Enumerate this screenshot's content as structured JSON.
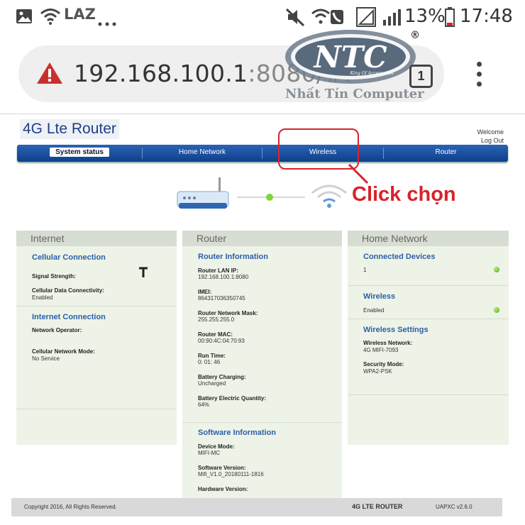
{
  "status_bar": {
    "carrier": "LAZ",
    "battery": "13%",
    "time": "17:48",
    "icons": [
      "gallery-icon",
      "wifi-icon",
      "more-dots-icon",
      "mute-icon",
      "wifi-call-icon",
      "signal-icon",
      "signal-icon",
      "battery-icon"
    ]
  },
  "browser": {
    "url_host": "192.168.100.1",
    "url_rest": ":8080/#.",
    "tab_count": "1",
    "warning_icon": "warning-triangle-icon",
    "menu_icon": "kebab-menu-icon"
  },
  "watermark": {
    "brand": "NTC",
    "tagline": "King Of Accessories",
    "name": "Nhất Tín Computer",
    "registered": "®"
  },
  "header": {
    "title": "4G Lte Router",
    "welcome": "Welcome",
    "logout": "Log Out"
  },
  "nav": {
    "items": [
      {
        "label": "System status",
        "active": true
      },
      {
        "label": "Home Network"
      },
      {
        "label": "Wireless"
      },
      {
        "label": "Router"
      }
    ]
  },
  "annotation": {
    "label": "Click chọn",
    "color": "#d8232a"
  },
  "panels": {
    "internet": {
      "title": "Internet",
      "cellular_title": "Cellular Connection",
      "signal_label": "Signal Strength:",
      "data_conn_label": "Cellular Data Connectivity:",
      "data_conn_value": "Enabled",
      "inet_title": "Internet Connection",
      "operator_label": "Network Operator:",
      "operator_value": "",
      "mode_label": "Cellular Network Mode:",
      "mode_value": "No Service"
    },
    "router": {
      "title": "Router",
      "info_title": "Router Information",
      "fields": [
        {
          "label": "Router LAN IP:",
          "value": "192.168.100.1:8080"
        },
        {
          "label": "IMEI:",
          "value": "864317036350745"
        },
        {
          "label": "Router Network Mask:",
          "value": "255.255.255.0"
        },
        {
          "label": "Router MAC:",
          "value": "00:90:4C:04:70:93"
        },
        {
          "label": "Run Time:",
          "value": "0: 01: 46"
        },
        {
          "label": "Battery Charging:",
          "value": "Uncharged"
        },
        {
          "label": "Battery Electric Quantity:",
          "value": "64%"
        }
      ],
      "sw_title": "Software Information",
      "sw_fields": [
        {
          "label": "Device Mode:",
          "value": "MIFI-MC"
        },
        {
          "label": "Software Version:",
          "value": "Mifi_V1.0_20180111-1816"
        },
        {
          "label": "Hardware Version:",
          "value": ""
        }
      ]
    },
    "home": {
      "title": "Home Network",
      "devices_title": "Connected Devices",
      "devices_value": "1",
      "wireless_title": "Wireless",
      "wireless_value": "Enabled",
      "settings_title": "Wireless Settings",
      "network_label": "Wireless Network:",
      "network_value": "4G MIFI-7093",
      "security_label": "Security Mode:",
      "security_value": "WPA2-PSK"
    }
  },
  "footer": {
    "copyright": "Copyright 2016, All Rights Reserved.",
    "product": "4G LTE ROUTER",
    "version": "UAPXC v2.6.0"
  }
}
